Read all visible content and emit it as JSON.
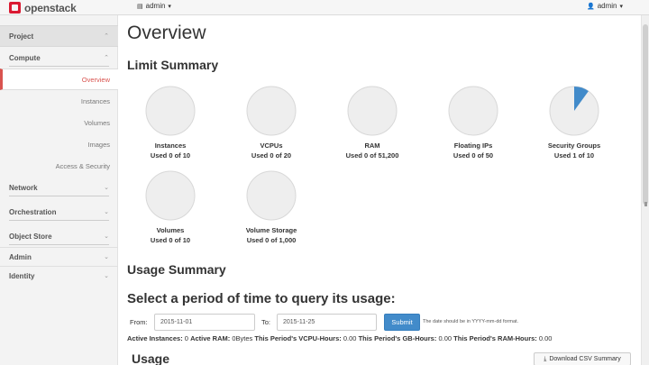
{
  "topbar": {
    "logo_text": "openstack",
    "project_label": "admin",
    "user_label": "admin"
  },
  "sidebar": {
    "project": "Project",
    "compute": "Compute",
    "compute_items": [
      {
        "label": "Overview",
        "active": true
      },
      {
        "label": "Instances"
      },
      {
        "label": "Volumes"
      },
      {
        "label": "Images"
      },
      {
        "label": "Access & Security"
      }
    ],
    "network": "Network",
    "orchestration": "Orchestration",
    "object_store": "Object Store",
    "admin": "Admin",
    "identity": "Identity"
  },
  "main": {
    "title": "Overview",
    "limit_summary": "Limit Summary",
    "usage_summary": "Usage Summary",
    "period_heading": "Select a period of time to query its usage:",
    "usage_heading": "Usage",
    "limits": [
      {
        "name": "Instances",
        "used_text": "Used 0 of 10",
        "fraction": 0
      },
      {
        "name": "VCPUs",
        "used_text": "Used 0 of 20",
        "fraction": 0
      },
      {
        "name": "RAM",
        "used_text": "Used 0 of 51,200",
        "fraction": 0
      },
      {
        "name": "Floating IPs",
        "used_text": "Used 0 of 50",
        "fraction": 0
      },
      {
        "name": "Security Groups",
        "used_text": "Used 1 of 10",
        "fraction": 0.1
      },
      {
        "name": "Volumes",
        "used_text": "Used 0 of 10",
        "fraction": 0
      },
      {
        "name": "Volume Storage",
        "used_text": "Used 0 of 1,000",
        "fraction": 0
      }
    ],
    "form": {
      "from_label": "From:",
      "from_value": "2015-11-01",
      "to_label": "To:",
      "to_value": "2015-11-25",
      "submit_label": "Submit",
      "hint": "The date should be in YYYY-mm-dd format."
    },
    "stats": {
      "active_instances_label": "Active Instances:",
      "active_instances_value": "0",
      "active_ram_label": "Active RAM:",
      "active_ram_value": "0Bytes",
      "vcpu_hours_label": "This Period's VCPU-Hours:",
      "vcpu_hours_value": "0.00",
      "gb_hours_label": "This Period's GB-Hours:",
      "gb_hours_value": "0.00",
      "ram_hours_label": "This Period's RAM-Hours:",
      "ram_hours_value": "0.00"
    },
    "csv_button": "Download CSV Summary"
  },
  "colors": {
    "brand_red": "#da1a32",
    "pie_used": "#428bca",
    "pie_empty": "#eeeeee",
    "active_nav": "#d9534f"
  }
}
